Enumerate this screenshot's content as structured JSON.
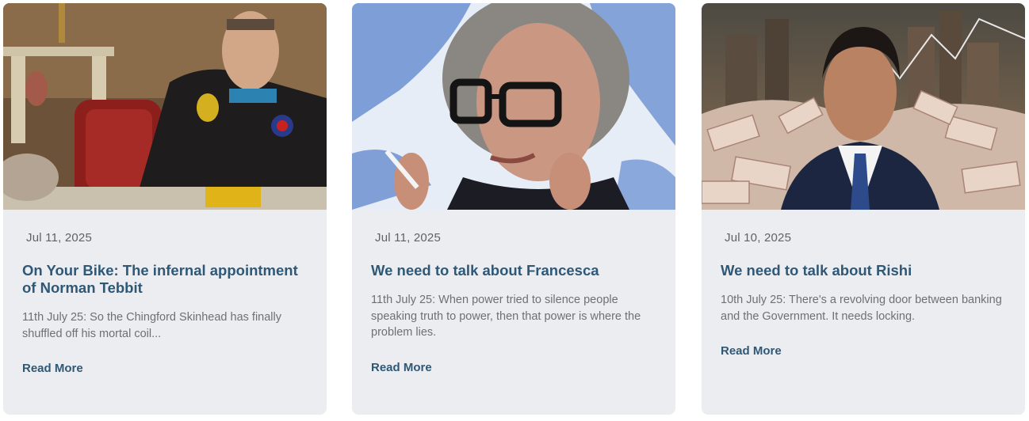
{
  "posts": [
    {
      "date": "Jul 11, 2025",
      "title": "On Your Bike: The infernal appointment of Norman Tebbit",
      "excerpt": "11th July 25: So the Chingford Skinhead has finally shuffled off his mortal coil...",
      "read_more": "Read More"
    },
    {
      "date": "Jul 11, 2025",
      "title": "We need to talk about Francesca",
      "excerpt": "11th July 25: When power tried to silence people speaking truth to power, then that power is where the problem lies.",
      "read_more": "Read More"
    },
    {
      "date": "Jul 10, 2025",
      "title": "We need to talk about Rishi",
      "excerpt": "10th July 25: There's a revolving door between banking and the Government. It needs locking.",
      "read_more": "Read More"
    }
  ]
}
